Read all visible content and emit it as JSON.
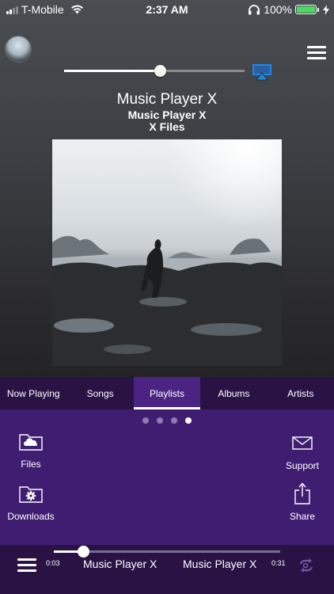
{
  "status_bar": {
    "carrier": "T-Mobile",
    "time": "2:37 AM",
    "battery_percent": "100%",
    "battery_level": 1.0,
    "icons": [
      "signal-icon",
      "wifi-icon",
      "headphones-icon",
      "battery-icon",
      "charging-icon"
    ]
  },
  "volume": {
    "level": 0.53
  },
  "now_playing": {
    "title": "Music Player X",
    "artist": "Music Player X",
    "album": "X Files"
  },
  "tabs": [
    {
      "label": "Now Playing",
      "active": false
    },
    {
      "label": "Songs",
      "active": false
    },
    {
      "label": "Playlists",
      "active": true
    },
    {
      "label": "Albums",
      "active": false
    },
    {
      "label": "Artists",
      "active": false
    }
  ],
  "page_dots": {
    "count": 4,
    "active_index": 3
  },
  "actions": {
    "files": {
      "label": "Files",
      "icon": "cloud-folder-icon"
    },
    "downloads": {
      "label": "Downloads",
      "icon": "gear-folder-icon"
    },
    "support": {
      "label": "Support",
      "icon": "envelope-icon"
    },
    "share": {
      "label": "Share",
      "icon": "share-icon"
    }
  },
  "player": {
    "elapsed": "0:03",
    "remaining": "0:31",
    "progress": 0.13,
    "title_primary": "Music Player X",
    "title_secondary": "Music Player X"
  },
  "colors": {
    "tab_bar": "#2a1245",
    "tab_active": "#4a2383",
    "panel": "#3f1e72",
    "airplay_accent": "#1e88e5",
    "battery_green": "#4cd964"
  }
}
